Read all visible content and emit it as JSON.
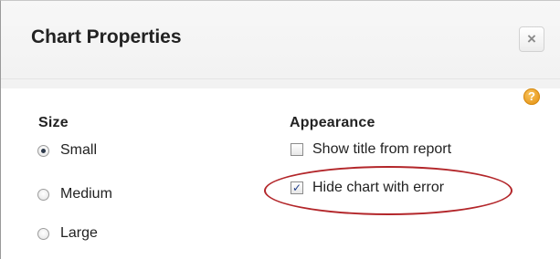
{
  "dialog": {
    "title": "Chart Properties",
    "close_symbol": "×",
    "help_symbol": "?"
  },
  "size": {
    "heading": "Size",
    "options": [
      {
        "label": "Small",
        "checked": true
      },
      {
        "label": "Medium",
        "checked": false
      },
      {
        "label": "Large",
        "checked": false
      }
    ]
  },
  "appearance": {
    "heading": "Appearance",
    "options": [
      {
        "label": "Show title from report",
        "checked": false
      },
      {
        "label": "Hide chart with error",
        "checked": true
      }
    ],
    "check_symbol": "✓"
  },
  "annotation": {
    "highlight_color": "#b3262a"
  }
}
